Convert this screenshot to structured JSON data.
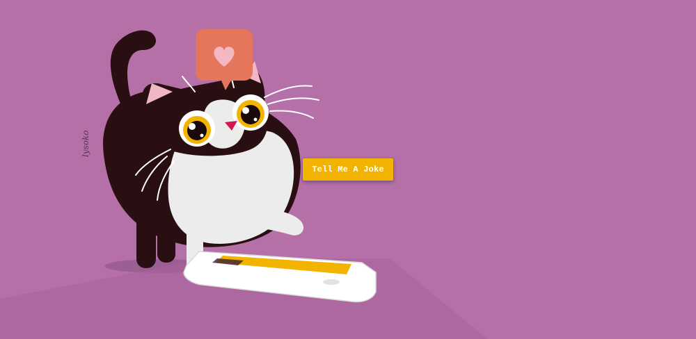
{
  "scene": {
    "illustration": "cat-with-phone",
    "heart_icon": "heart-icon"
  },
  "colors": {
    "background": "#b570a8",
    "button": "#f2b400",
    "button_text": "#ffffff",
    "cat_dark": "#2a0f12",
    "cat_light": "#ececec",
    "bubble": "#e5765c",
    "heart": "#f4b8c3"
  },
  "button": {
    "label": "Tell Me A Joke"
  },
  "signature": "lysoko"
}
